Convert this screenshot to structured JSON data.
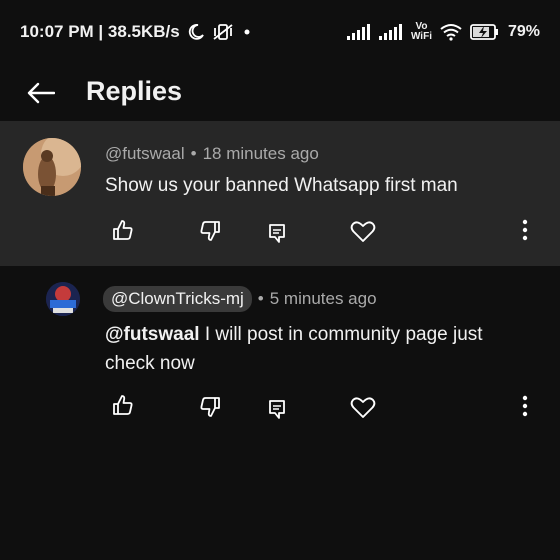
{
  "status_bar": {
    "time_speed": "10:07 PM | 38.5KB/s",
    "wifi_label_top": "Vo",
    "wifi_label_bottom": "WiFi",
    "battery": "79%"
  },
  "header": {
    "title": "Replies"
  },
  "comment": {
    "author": "@futswaal",
    "separator": "•",
    "time": "18 minutes ago",
    "text": "Show us your banned Whatsapp first man"
  },
  "reply": {
    "author": "@ClownTricks-mj",
    "separator": "•",
    "time": "5 minutes ago",
    "mention": "@futswaal",
    "text": " I will post in community page just check now"
  },
  "icons": {
    "like": "thumbs-up-icon",
    "dislike": "thumbs-down-icon",
    "reply": "reply-icon",
    "heart": "heart-icon",
    "more": "more-vertical-icon"
  }
}
